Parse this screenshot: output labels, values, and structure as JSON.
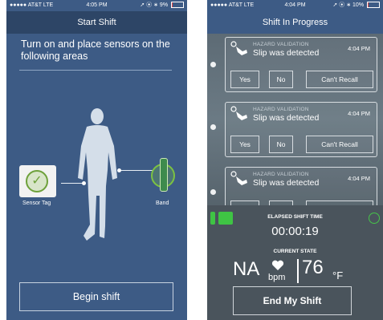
{
  "left": {
    "status": {
      "carrier": "●●●●● AT&T  LTE",
      "time": "4:05 PM",
      "right": "➚ ⦿ ∗ 9%",
      "battery_pct": 9
    },
    "title": "Start Shift",
    "instruction": "Turn on and place sensors on the following areas",
    "sensor_tag_label": "Sensor Tag",
    "band_label": "Band",
    "begin_button": "Begin shift"
  },
  "right": {
    "status": {
      "carrier": "●●●●● AT&T  LTE",
      "time": "4:04 PM",
      "right": "➚ ⦿ ∗ 10%",
      "battery_pct": 10
    },
    "title": "Shift In Progress",
    "cards": [
      {
        "kind": "HAZARD VALIDATION",
        "message": "Slip was detected",
        "time": "4:04 PM",
        "options": [
          "Yes",
          "No",
          "Can't Recall"
        ]
      },
      {
        "kind": "HAZARD VALIDATION",
        "message": "Slip was detected",
        "time": "4:04 PM",
        "options": [
          "Yes",
          "No",
          "Can't Recall"
        ]
      },
      {
        "kind": "HAZARD VALIDATION",
        "message": "Slip was detected",
        "time": "4:04 PM",
        "options": []
      }
    ],
    "elapsed_label": "ELAPSED SHIFT TIME",
    "elapsed_value": "00:00:19",
    "current_state_label": "CURRENT STATE",
    "heart_rate": "NA",
    "heart_unit": "bpm",
    "temperature": "76",
    "temp_unit": "°F",
    "end_button": "End My Shift"
  },
  "colors": {
    "left_bg": "#3d5b85",
    "left_nav": "#2d4566",
    "right_nav": "#3d5b85",
    "panel": "#4a545c",
    "accent_green": "#3fc444",
    "battery_low": "#e04a4a"
  },
  "icons": [
    "hand-slip-icon",
    "heart-icon",
    "battery-icon",
    "check-icon",
    "rss-icon",
    "sensor-tag-icon",
    "band-icon"
  ]
}
